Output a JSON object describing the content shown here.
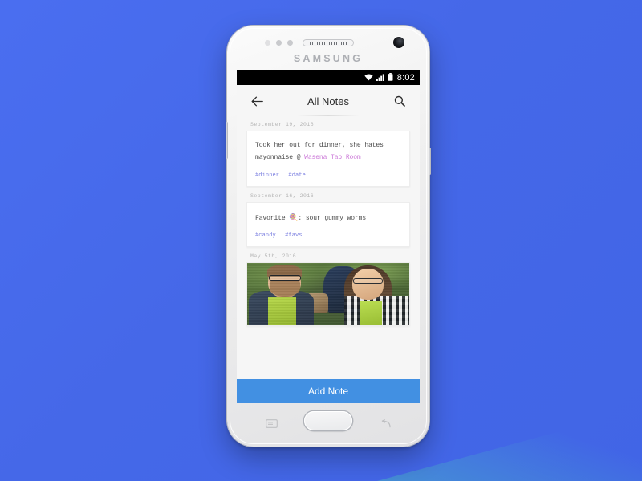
{
  "background": {
    "color": "#4568E8",
    "accent_corner_color": "#4696d2"
  },
  "device": {
    "brand": "SAMSUNG",
    "icons": {
      "earpiece": "speaker-grille-icon",
      "camera": "front-camera-icon",
      "proximity": "proximity-sensor-icon",
      "home": "home-button-icon",
      "recents": "recents-nav-icon",
      "back_nav": "back-nav-icon",
      "volume": "volume-button-icon",
      "power": "power-button-icon"
    }
  },
  "status_bar": {
    "clock": "8:02",
    "icons": [
      "wifi-icon",
      "cellular-signal-icon",
      "battery-icon"
    ]
  },
  "app_bar": {
    "title": "All Notes",
    "back_icon": "back-arrow-icon",
    "search_icon": "search-icon"
  },
  "notes": [
    {
      "date": "September 19, 2016",
      "text_before": "Took her out for dinner, she hates mayonnaise @ ",
      "location": "Wasena Tap Room",
      "emoji": "",
      "text_after": "",
      "tags": [
        "#dinner",
        "#date"
      ],
      "type": "text"
    },
    {
      "date": "September 16, 2016",
      "text_before": "Favorite ",
      "emoji": "🍭",
      "text_after": ": sour gummy worms",
      "location": "",
      "tags": [
        "#candy",
        "#favs"
      ],
      "type": "text"
    },
    {
      "date": "May 5th, 2016",
      "text_before": "",
      "emoji": "",
      "text_after": "",
      "location": "",
      "tags": [],
      "type": "photo",
      "photo_alt": "Two people wearing green aprons smiling outdoors"
    }
  ],
  "add_note": {
    "label": "Add Note",
    "color": "#4290e2"
  },
  "colors": {
    "tag": "#7b7fe0",
    "location": "#cc7ad8",
    "date": "#b4b4b4",
    "note_text": "#4b4b4b"
  }
}
